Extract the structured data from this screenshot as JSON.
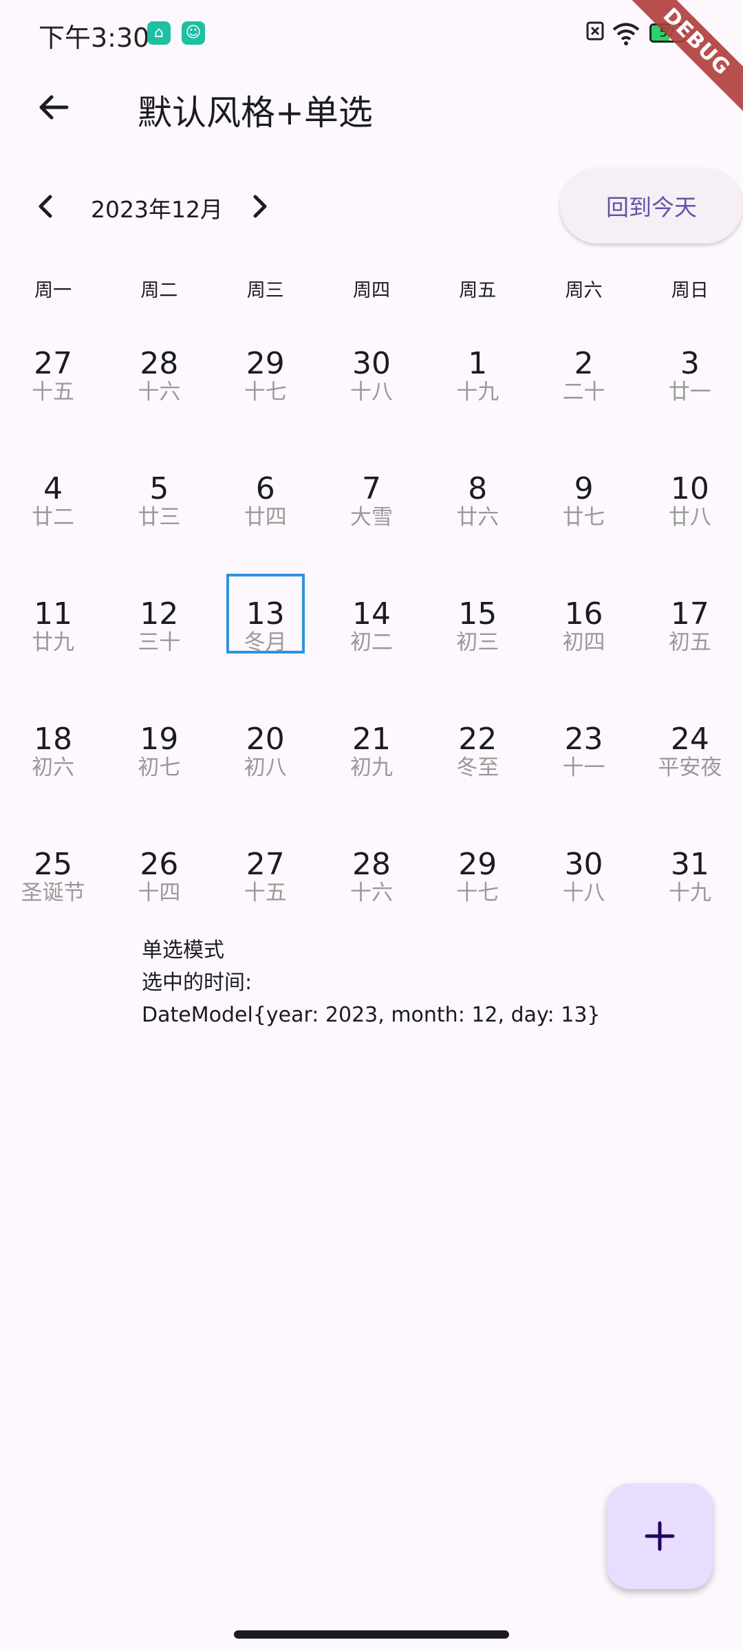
{
  "status_bar": {
    "time": "下午3:30",
    "battery": "57"
  },
  "debug_banner": "DEBUG",
  "app_bar": {
    "title": "默认风格+单选"
  },
  "calendar": {
    "month_label": "2023年12月",
    "today_button": "回到今天",
    "weekdays": [
      "周一",
      "周二",
      "周三",
      "周四",
      "周五",
      "周六",
      "周日"
    ],
    "selected_day": "13",
    "days": [
      {
        "day": "27",
        "lunar": "十五"
      },
      {
        "day": "28",
        "lunar": "十六"
      },
      {
        "day": "29",
        "lunar": "十七"
      },
      {
        "day": "30",
        "lunar": "十八"
      },
      {
        "day": "1",
        "lunar": "十九"
      },
      {
        "day": "2",
        "lunar": "二十"
      },
      {
        "day": "3",
        "lunar": "廿一"
      },
      {
        "day": "4",
        "lunar": "廿二"
      },
      {
        "day": "5",
        "lunar": "廿三"
      },
      {
        "day": "6",
        "lunar": "廿四"
      },
      {
        "day": "7",
        "lunar": "大雪"
      },
      {
        "day": "8",
        "lunar": "廿六"
      },
      {
        "day": "9",
        "lunar": "廿七"
      },
      {
        "day": "10",
        "lunar": "廿八"
      },
      {
        "day": "11",
        "lunar": "廿九"
      },
      {
        "day": "12",
        "lunar": "三十"
      },
      {
        "day": "13",
        "lunar": "冬月"
      },
      {
        "day": "14",
        "lunar": "初二"
      },
      {
        "day": "15",
        "lunar": "初三"
      },
      {
        "day": "16",
        "lunar": "初四"
      },
      {
        "day": "17",
        "lunar": "初五"
      },
      {
        "day": "18",
        "lunar": "初六"
      },
      {
        "day": "19",
        "lunar": "初七"
      },
      {
        "day": "20",
        "lunar": "初八"
      },
      {
        "day": "21",
        "lunar": "初九"
      },
      {
        "day": "22",
        "lunar": "冬至"
      },
      {
        "day": "23",
        "lunar": "十一"
      },
      {
        "day": "24",
        "lunar": "平安夜"
      },
      {
        "day": "25",
        "lunar": "圣诞节"
      },
      {
        "day": "26",
        "lunar": "十四"
      },
      {
        "day": "27",
        "lunar": "十五"
      },
      {
        "day": "28",
        "lunar": "十六"
      },
      {
        "day": "29",
        "lunar": "十七"
      },
      {
        "day": "30",
        "lunar": "十八"
      },
      {
        "day": "31",
        "lunar": "十九"
      }
    ]
  },
  "info": {
    "mode": "单选模式",
    "selected_label": "选中的时间:",
    "selected_value": "DateModel{year: 2023, month: 12, day: 13}"
  },
  "fab": {
    "icon": "plus-icon"
  },
  "colors": {
    "background": "#fdf8fd",
    "accent": "#6750a4",
    "selection_border": "#2f93dd",
    "lunar_text": "#999999",
    "fab_background": "#e9ddff"
  }
}
